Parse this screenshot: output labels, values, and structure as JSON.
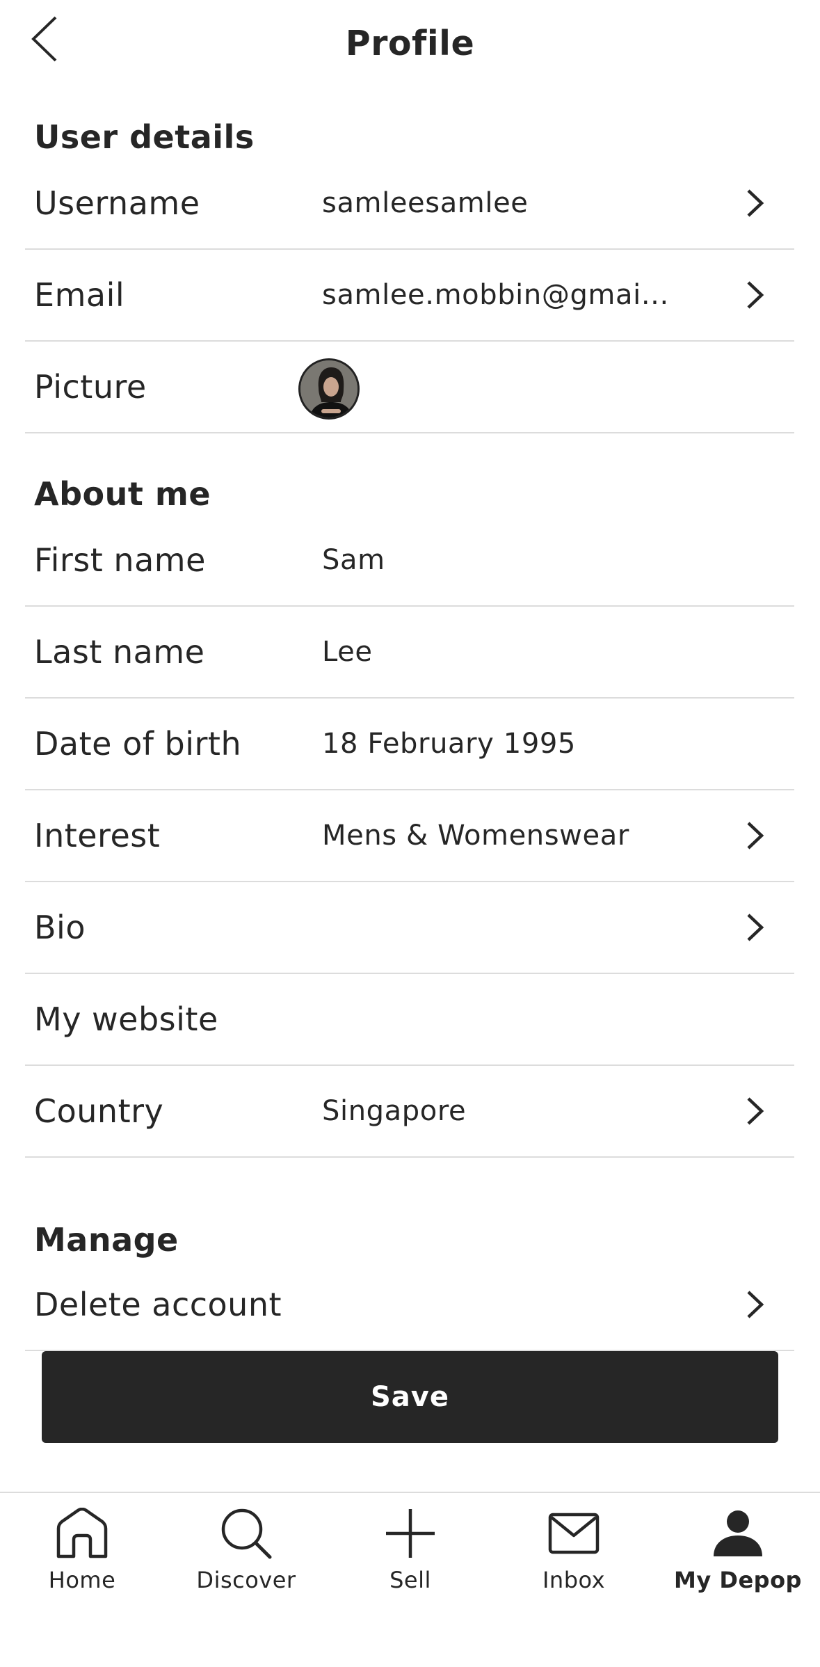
{
  "header": {
    "title": "Profile",
    "back_icon": "chevron-left-icon"
  },
  "sections": {
    "user_details": "User details",
    "about_me": "About me",
    "manage": "Manage"
  },
  "user_details": {
    "username": {
      "label": "Username",
      "value": "samleesamlee"
    },
    "email": {
      "label": "Email",
      "value": "samlee.mobbin@gmai..."
    },
    "picture": {
      "label": "Picture"
    }
  },
  "about_me": {
    "first_name": {
      "label": "First name",
      "value": "Sam"
    },
    "last_name": {
      "label": "Last name",
      "value": "Lee"
    },
    "dob": {
      "label": "Date of birth",
      "value": "18 February 1995"
    },
    "interest": {
      "label": "Interest",
      "value": "Mens & Womenswear"
    },
    "bio": {
      "label": "Bio",
      "value": ""
    },
    "website": {
      "label": "My website",
      "value": ""
    },
    "country": {
      "label": "Country",
      "value": "Singapore"
    }
  },
  "manage": {
    "delete_account": {
      "label": "Delete account"
    }
  },
  "save_label": "Save",
  "tabbar": {
    "items": [
      {
        "label": "Home",
        "icon": "home-icon",
        "active": false
      },
      {
        "label": "Discover",
        "icon": "search-icon",
        "active": false
      },
      {
        "label": "Sell",
        "icon": "plus-icon",
        "active": false
      },
      {
        "label": "Inbox",
        "icon": "mail-icon",
        "active": false
      },
      {
        "label": "My Depop",
        "icon": "person-icon",
        "active": true
      }
    ]
  },
  "colors": {
    "text": "#262626",
    "divider": "#dcdcdc",
    "button_bg": "#262626",
    "button_text": "#ffffff"
  }
}
